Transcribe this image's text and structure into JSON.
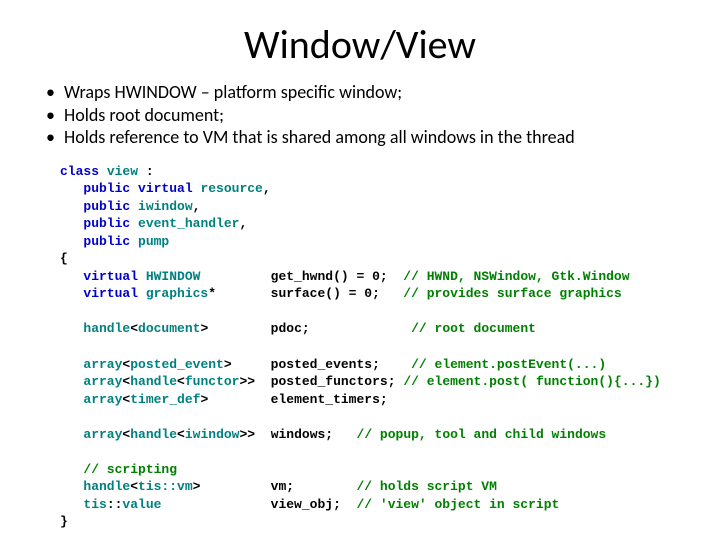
{
  "title": "Window/View",
  "bullets": [
    "Wraps HWINDOW – platform specific window;",
    "Holds root document;",
    "Holds reference to VM that is shared among all windows in the thread"
  ],
  "code": {
    "k_class": "class",
    "k_view": "view",
    "k_colon": " :",
    "k_public1": "public",
    "k_virtual": "virtual",
    "t_resource": "resource",
    "t_iwindow": "iwindow",
    "t_event_handler": "event_handler",
    "t_pump": "pump",
    "k_virtual2": "virtual",
    "t_HWINDOW": "HWINDOW",
    "m_get_hwnd": "get_hwnd() = 0;",
    "c_hwnd": "// HWND, NSWindow, Gtk.Window",
    "t_graphics": "graphics",
    "m_surface": "surface() = 0;",
    "c_surface": "// provides surface graphics",
    "t_handle": "handle",
    "t_document": "document",
    "m_pdoc": "pdoc;",
    "c_pdoc": "// root document",
    "t_array": "array",
    "t_posted_event": "posted_event",
    "m_posted_events": "posted_events;",
    "c_posted_events": "// element.postEvent(...)",
    "t_functor": "functor",
    "m_posted_functors": "posted_functors;",
    "c_posted_functors": "// element.post( function(){...})",
    "t_timer_def": "timer_def",
    "m_element_timers": "element_timers;",
    "m_windows": "windows;",
    "c_windows": "// popup, tool and child windows",
    "c_scripting": "// scripting",
    "t_tis_vm": "tis::vm",
    "m_vm": "vm;",
    "c_vm": "// holds script VM",
    "t_tis": "tis",
    "t_value": "value",
    "m_view_obj": "view_obj;",
    "c_view_obj": "// 'view' object in script"
  }
}
